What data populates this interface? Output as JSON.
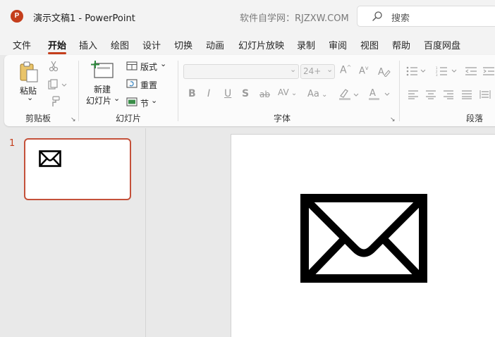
{
  "app": {
    "logo_letter": "P",
    "title": "演示文稿1  -  PowerPoint",
    "watermark": "软件自学网：RJZXW.COM",
    "search_placeholder": "搜索"
  },
  "tabs": [
    "文件",
    "开始",
    "插入",
    "绘图",
    "设计",
    "切换",
    "动画",
    "幻灯片放映",
    "录制",
    "审阅",
    "视图",
    "帮助",
    "百度网盘"
  ],
  "active_tab": "开始",
  "ribbon": {
    "clipboard": {
      "paste_label": "粘贴",
      "paste_arrow": "⌄",
      "group_label": "剪贴板"
    },
    "slides": {
      "new_slide_line1": "新建",
      "new_slide_line2": "幻灯片",
      "layout_label": "版式",
      "reset_label": "重置",
      "section_label": "节",
      "group_label": "幻灯片"
    },
    "font": {
      "font_name": "",
      "font_size": "24+",
      "group_label": "字体"
    },
    "paragraph": {
      "group_label": "段落"
    }
  },
  "slide_pane": {
    "slide_number": "1"
  },
  "colors": {
    "accent": "#c43e1c",
    "thumb_border": "#c4513a",
    "background": "#e9e9e9",
    "titlebar": "#f3f3f3"
  },
  "icons": {
    "slide_content": "envelope-icon"
  }
}
